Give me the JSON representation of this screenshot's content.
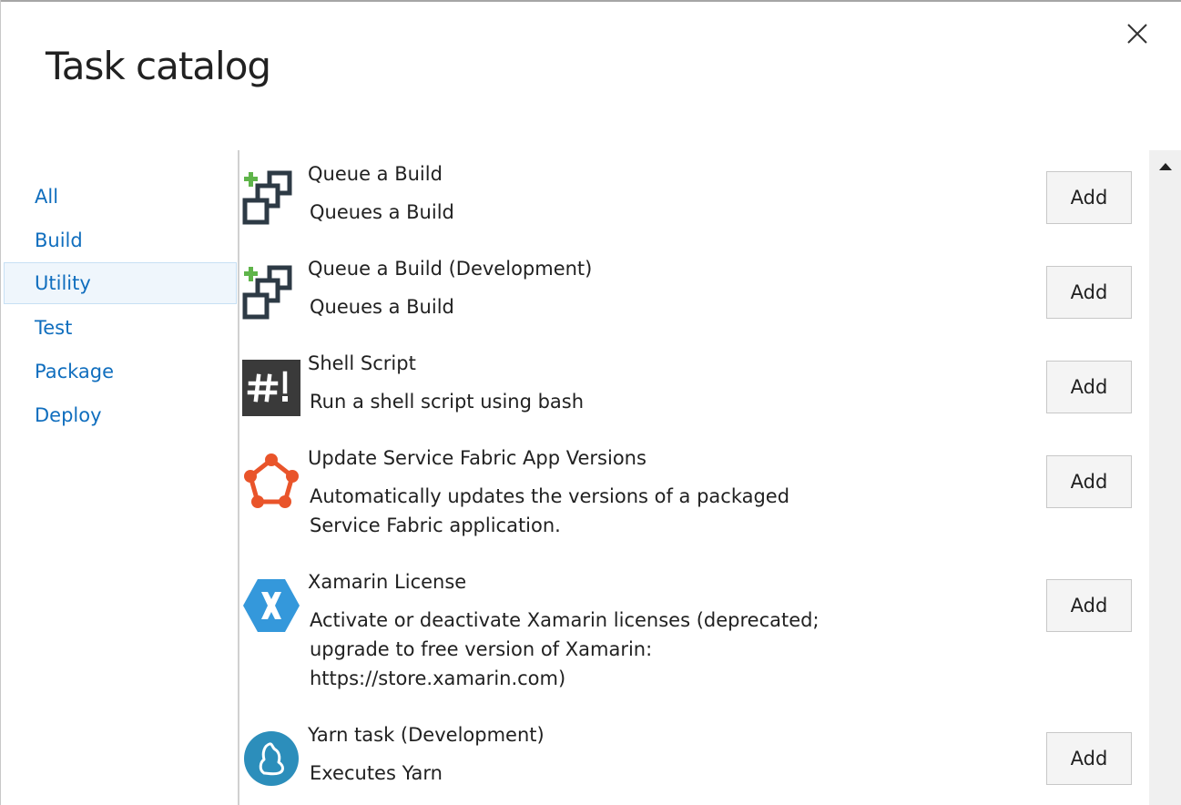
{
  "dialog": {
    "title": "Task catalog"
  },
  "sidebar": {
    "items": [
      {
        "label": "All",
        "selected": false
      },
      {
        "label": "Build",
        "selected": false
      },
      {
        "label": "Utility",
        "selected": true
      },
      {
        "label": "Test",
        "selected": false
      },
      {
        "label": "Package",
        "selected": false
      },
      {
        "label": "Deploy",
        "selected": false
      }
    ]
  },
  "tasks": [
    {
      "name": "Queue a Build",
      "description": [
        "Queues a Build"
      ],
      "icon": "queue-build-icon",
      "add_label": "Add"
    },
    {
      "name": "Queue a Build (Development)",
      "description": [
        "Queues a Build"
      ],
      "icon": "queue-build-icon",
      "add_label": "Add"
    },
    {
      "name": "Shell Script",
      "description": [
        "Run a shell script using bash"
      ],
      "icon": "shell-script-icon",
      "add_label": "Add"
    },
    {
      "name": "Update Service Fabric App Versions",
      "description": [
        "Automatically updates the versions of a packaged",
        "Service Fabric application."
      ],
      "icon": "service-fabric-icon",
      "add_label": "Add"
    },
    {
      "name": "Xamarin License",
      "description": [
        "Activate or deactivate Xamarin licenses (deprecated;",
        "upgrade to free version of Xamarin:",
        "https://store.xamarin.com)"
      ],
      "icon": "xamarin-icon",
      "add_label": "Add"
    },
    {
      "name": "Yarn task (Development)",
      "description": [
        "Executes Yarn"
      ],
      "icon": "yarn-icon",
      "add_label": "Add"
    }
  ],
  "colors": {
    "link": "#106ebe",
    "selected_bg": "#eff6fc",
    "fabric_orange": "#e9542a",
    "xamarin_blue": "#3498db",
    "yarn_blue": "#2c8ebb",
    "plus_green": "#5fb44a"
  }
}
